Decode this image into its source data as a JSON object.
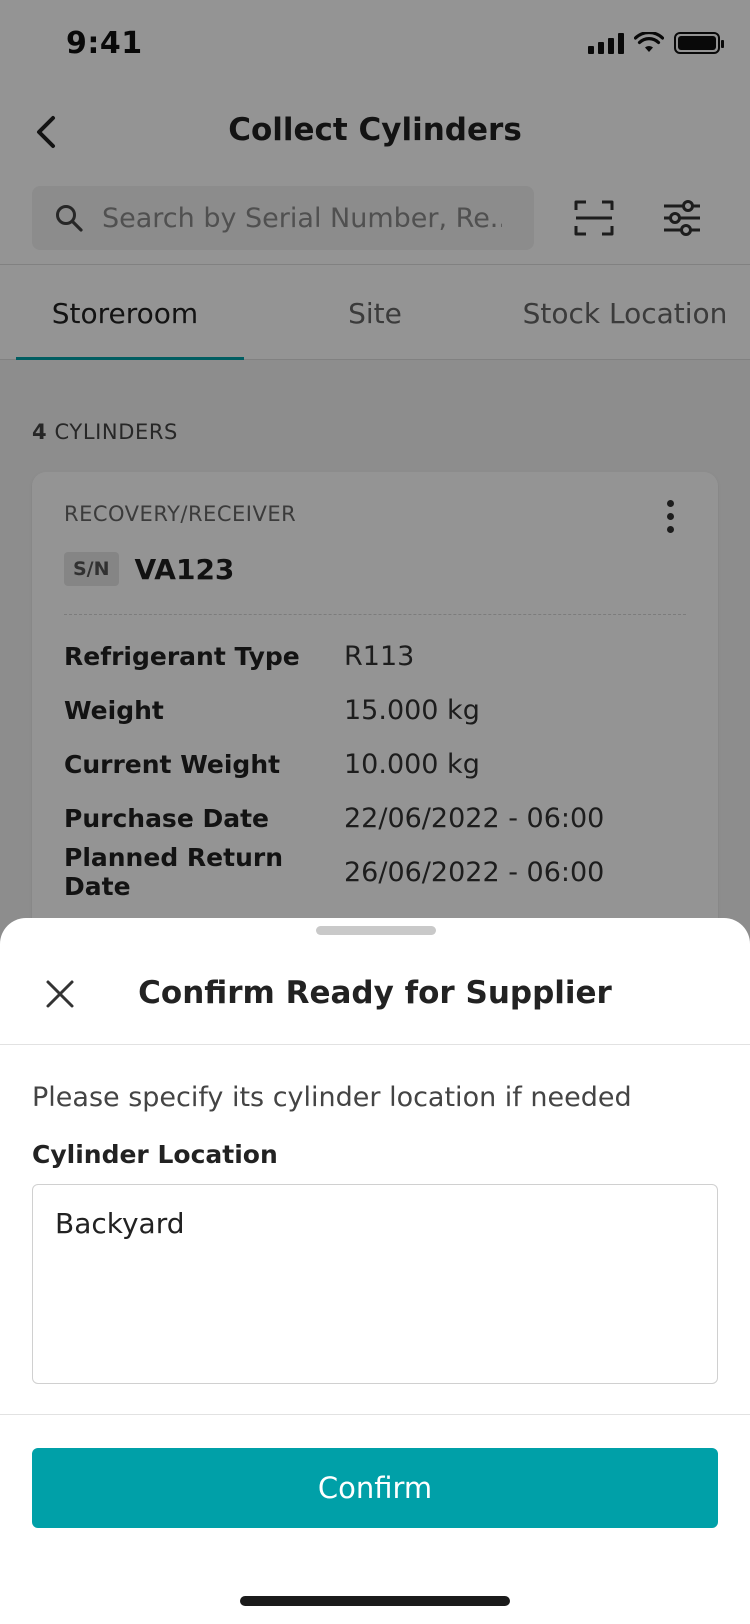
{
  "status_bar": {
    "time": "9:41"
  },
  "header": {
    "title": "Collect Cylinders",
    "back_icon": "chevron-left-icon"
  },
  "search": {
    "placeholder": "Search by Serial Number, Re...",
    "icon": "search-icon",
    "scan_icon": "scan-icon",
    "filter_icon": "filter-icon"
  },
  "tabs": [
    {
      "label": "Storeroom",
      "active": true
    },
    {
      "label": "Site",
      "active": false
    },
    {
      "label": "Stock Location",
      "active": false
    }
  ],
  "list": {
    "count": "4",
    "count_suffix": "CYLINDERS",
    "card": {
      "type": "RECOVERY/RECEIVER",
      "sn_badge": "S/N",
      "serial": "VA123",
      "details": [
        {
          "label": "Refrigerant Type",
          "value": "R113"
        },
        {
          "label": "Weight",
          "value": "15.000 kg"
        },
        {
          "label": "Current Weight",
          "value": "10.000 kg"
        },
        {
          "label": "Purchase Date",
          "value": "22/06/2022 - 06:00"
        },
        {
          "label": "Planned Return Date",
          "value": "26/06/2022 - 06:00"
        }
      ]
    }
  },
  "sheet": {
    "title": "Confirm Ready for Supplier",
    "instruction": "Please specify its cylinder location if needed",
    "field_label": "Cylinder Location",
    "field_value": "Backyard",
    "confirm_label": "Confirm",
    "close_icon": "close-icon"
  },
  "colors": {
    "accent": "#00a0a8"
  }
}
